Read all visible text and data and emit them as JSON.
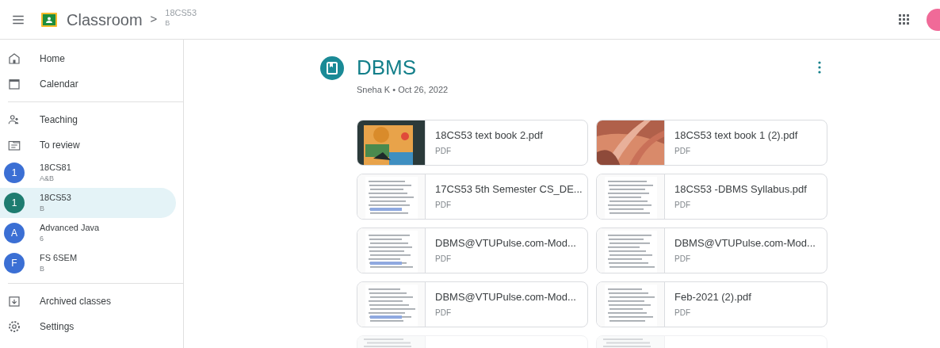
{
  "topbar": {
    "app_name": "Classroom",
    "separator": ">",
    "breadcrumb": {
      "title": "18CS53",
      "subtitle": "B"
    }
  },
  "sidebar": {
    "groups": [
      [
        {
          "kind": "nav",
          "label": "Home",
          "selected": false
        },
        {
          "kind": "nav",
          "label": "Calendar",
          "selected": false
        }
      ],
      [
        {
          "kind": "nav",
          "label": "Teaching",
          "selected": false
        },
        {
          "kind": "nav",
          "label": "To review",
          "selected": false
        },
        {
          "kind": "class",
          "letter": "1",
          "label": "18CS81",
          "subtitle": "A&B",
          "color": "#3b6fd4",
          "selected": false
        },
        {
          "kind": "class",
          "letter": "1",
          "label": "18CS53",
          "subtitle": "B",
          "color": "#1e7c70",
          "selected": true
        },
        {
          "kind": "class",
          "letter": "A",
          "label": "Advanced Java",
          "subtitle": "6",
          "color": "#3b6fd4",
          "selected": false
        },
        {
          "kind": "class",
          "letter": "F",
          "label": "FS 6SEM",
          "subtitle": "B",
          "color": "#3b6fd4",
          "selected": false
        }
      ],
      [
        {
          "kind": "nav",
          "label": "Archived classes",
          "selected": false
        },
        {
          "kind": "nav",
          "label": "Settings",
          "selected": false
        }
      ]
    ]
  },
  "material": {
    "title": "DBMS",
    "meta": "Sneha K • Oct 26, 2022",
    "attachments": [
      {
        "kind": "book",
        "title": "18CS53 text book 2.pdf",
        "type": "PDF"
      },
      {
        "kind": "book",
        "title": "18CS53 text book 1 (2).pdf",
        "type": "PDF"
      },
      {
        "kind": "document",
        "title": "17CS53 5th Semester CS_DE...",
        "type": "PDF"
      },
      {
        "kind": "document",
        "title": "18CS53 -DBMS Syllabus.pdf",
        "type": "PDF"
      },
      {
        "kind": "document",
        "title": "DBMS@VTUPulse.com-Mod...",
        "type": "PDF"
      },
      {
        "kind": "document",
        "title": "DBMS@VTUPulse.com-Mod...",
        "type": "PDF"
      },
      {
        "kind": "document",
        "title": "DBMS@VTUPulse.com-Mod...",
        "type": "PDF"
      },
      {
        "kind": "document",
        "title": "Feb-2021 (2).pdf",
        "type": "PDF"
      },
      {
        "kind": "cut"
      },
      {
        "kind": "cut"
      }
    ]
  }
}
